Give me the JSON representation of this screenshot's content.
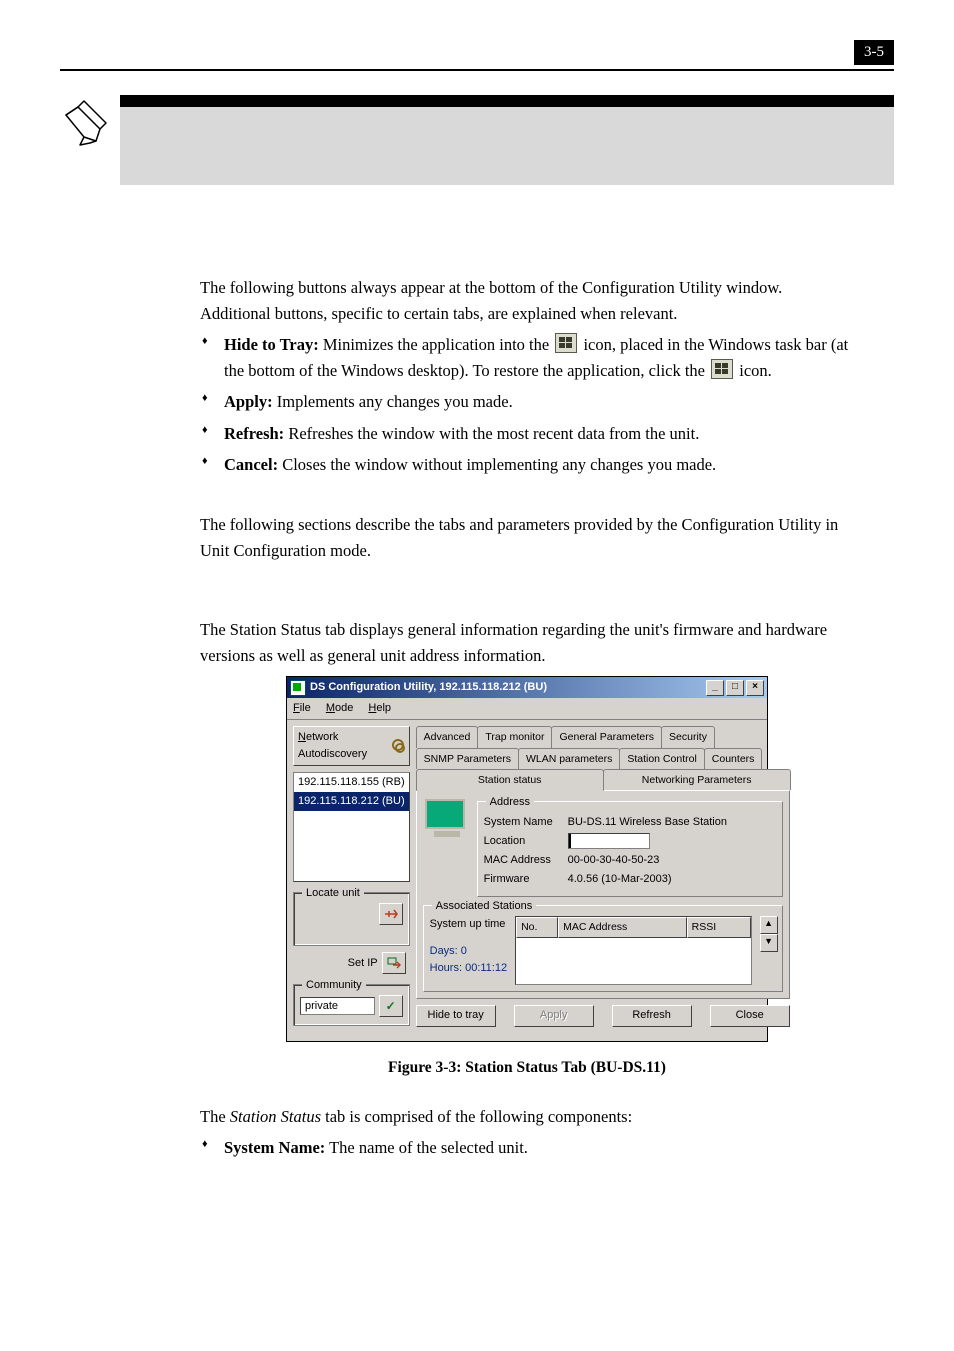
{
  "page_number": "3-5",
  "intro_para": "The following buttons always appear at the bottom of the Configuration Utility window. Additional buttons, specific to certain tabs, are explained when relevant.",
  "buttons_desc": {
    "hide_label": "Hide to Tray:",
    "hide_text_a": " Minimizes the application into the ",
    "hide_text_b": " icon, placed in the Windows task bar (at the bottom of the Windows desktop). To restore the application, click the ",
    "hide_text_c": " icon.",
    "apply_label": "Apply:",
    "apply_text": " Implements any changes you made.",
    "refresh_label": "Refresh:",
    "refresh_text": " Refreshes the window with the most recent data from the unit.",
    "cancel_label": "Cancel:",
    "cancel_text": " Closes the window without implementing any changes you made."
  },
  "section_para": "The following sections describe the tabs and parameters provided by the Configuration Utility in Unit Configuration mode.",
  "station_para": "The Station Status tab displays general information regarding the unit's firmware and hardware versions as well as general unit address information.",
  "figure_caption": "Figure 3-3: Station Status Tab (BU-DS.11)",
  "after_fig_para_a": "The ",
  "after_fig_em": "Station Status",
  "after_fig_para_b": " tab is comprised of the following components:",
  "sysname_label": "System Name:",
  "sysname_text": " The name of the selected unit.",
  "dialog": {
    "title": "DS Configuration Utility, 192.115.118.212  (BU)",
    "menu": {
      "file": "File",
      "mode": "Mode",
      "help": "Help"
    },
    "left": {
      "autodiscovery": "Network Autodiscovery",
      "list_items": [
        "192.115.118.155  (RB)",
        "192.115.118.212  (BU)"
      ],
      "locate_title": "Locate unit",
      "setip": "Set IP",
      "community_title": "Community",
      "community_value": "private"
    },
    "tabs_row1": [
      "Advanced",
      "Trap monitor",
      "General Parameters",
      "Security"
    ],
    "tabs_row2": [
      "SNMP Parameters",
      "WLAN parameters",
      "Station Control",
      "Counters"
    ],
    "tabs_row3": [
      "Station status",
      "Networking Parameters"
    ],
    "address": {
      "title": "Address",
      "system_name_lbl": "System Name",
      "system_name_val": "BU-DS.11 Wireless Base Station",
      "location_lbl": "Location",
      "mac_lbl": "MAC Address",
      "mac_val": "00-00-30-40-50-23",
      "fw_lbl": "Firmware",
      "fw_val": "4.0.56  (10-Mar-2003)"
    },
    "uptime": {
      "label": "System up time",
      "days": "Days:  0",
      "hours": "Hours: 00:11:12"
    },
    "assoc": {
      "title": "Associated Stations",
      "cols": [
        "No.",
        "MAC Address",
        "RSSI"
      ]
    },
    "bottom": {
      "hide": "Hide to tray",
      "apply": "Apply",
      "refresh": "Refresh",
      "close": "Close"
    }
  }
}
